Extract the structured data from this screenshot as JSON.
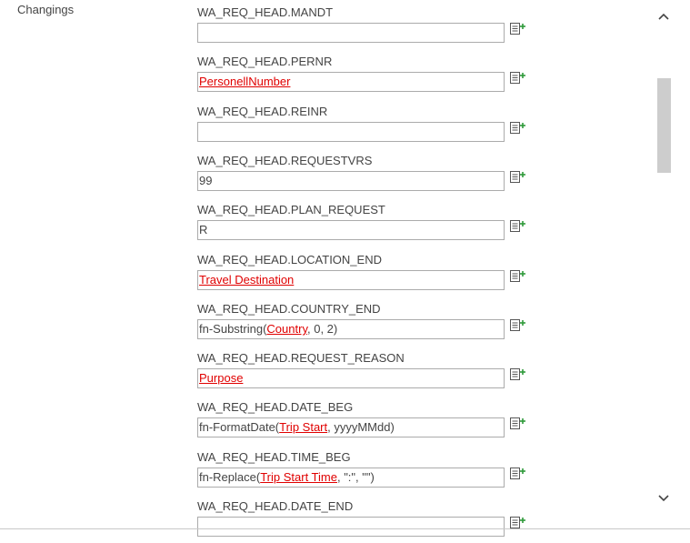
{
  "section": {
    "label": "Changings"
  },
  "fields": [
    {
      "label": "WA_REQ_HEAD.MANDT",
      "value": []
    },
    {
      "label": "WA_REQ_HEAD.PERNR",
      "value": [
        {
          "text": "PersonellNumber",
          "token": true
        }
      ]
    },
    {
      "label": "WA_REQ_HEAD.REINR",
      "value": []
    },
    {
      "label": "WA_REQ_HEAD.REQUESTVRS",
      "value": [
        {
          "text": "99",
          "token": false
        }
      ]
    },
    {
      "label": "WA_REQ_HEAD.PLAN_REQUEST",
      "value": [
        {
          "text": "R",
          "token": false
        }
      ]
    },
    {
      "label": "WA_REQ_HEAD.LOCATION_END",
      "value": [
        {
          "text": "Travel Destination",
          "token": true
        }
      ]
    },
    {
      "label": "WA_REQ_HEAD.COUNTRY_END",
      "value": [
        {
          "text": "fn-Substring(",
          "token": false
        },
        {
          "text": "Country",
          "token": true
        },
        {
          "text": ", 0, 2)",
          "token": false
        }
      ]
    },
    {
      "label": "WA_REQ_HEAD.REQUEST_REASON",
      "value": [
        {
          "text": "Purpose",
          "token": true
        }
      ]
    },
    {
      "label": "WA_REQ_HEAD.DATE_BEG",
      "value": [
        {
          "text": "fn-FormatDate(",
          "token": false
        },
        {
          "text": "Trip Start",
          "token": true
        },
        {
          "text": ", yyyyMMdd)",
          "token": false
        }
      ]
    },
    {
      "label": "WA_REQ_HEAD.TIME_BEG",
      "value": [
        {
          "text": "fn-Replace(",
          "token": false
        },
        {
          "text": "Trip Start Time",
          "token": true
        },
        {
          "text": ", \":\", \"\")",
          "token": false
        }
      ]
    },
    {
      "label": "WA_REQ_HEAD.DATE_END",
      "value": []
    }
  ],
  "icons": {
    "lookup": "insert-reference-icon",
    "scroll_up": "chevron-up-icon",
    "scroll_down": "chevron-down-icon"
  },
  "colors": {
    "token": "#e00000",
    "text": "#444444",
    "border": "#ababab",
    "icon_accent": "#2e9a3a",
    "scroll_thumb": "#cdcdcd"
  },
  "scroll": {
    "position_fraction": 0.15
  }
}
